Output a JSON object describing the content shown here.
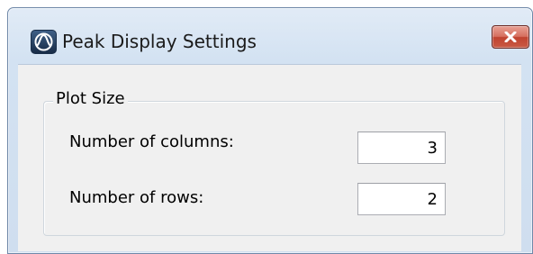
{
  "window": {
    "title": "Peak Display Settings",
    "app_icon": "peak-waveform-icon",
    "close_icon": "close-icon"
  },
  "plot_size": {
    "legend": "Plot Size",
    "columns_label": "Number of columns:",
    "columns_value": "3",
    "rows_label": "Number of rows:",
    "rows_value": "2"
  },
  "colors": {
    "title_bar": "#d3e2f2",
    "close_button": "#c9523f",
    "client_background": "#f0f0f0"
  }
}
